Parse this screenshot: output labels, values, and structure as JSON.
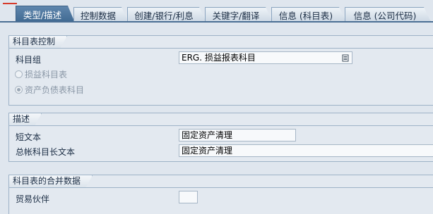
{
  "tabs": [
    {
      "label": "类型/描述",
      "active": true
    },
    {
      "label": "控制数据",
      "active": false
    },
    {
      "label": "创建/银行/利息",
      "active": false
    },
    {
      "label": "关键字/翻译",
      "active": false
    },
    {
      "label": "信息 (科目表)",
      "active": false
    },
    {
      "label": "信息 (公司代码)",
      "active": false
    }
  ],
  "coa_control": {
    "title": "科目表控制",
    "account_group_label": "科目组",
    "account_group_value": "ERG. 损益报表科目",
    "pl_radio_label": "损益科目表",
    "bs_radio_label": "资产负债表科目",
    "selected_radio": "bs"
  },
  "description": {
    "title": "描述",
    "short_text_label": "短文本",
    "short_text_value": "固定资产清理",
    "long_text_label": "总帐科目长文本",
    "long_text_value": "固定资产清理"
  },
  "consolidation": {
    "title": "科目表的合并数据",
    "trading_partner_label": "贸易伙伴",
    "trading_partner_value": ""
  },
  "colors": {
    "active_tab": "#4f78a1",
    "background": "#dfe6ee",
    "field": "#f7f9fb"
  }
}
